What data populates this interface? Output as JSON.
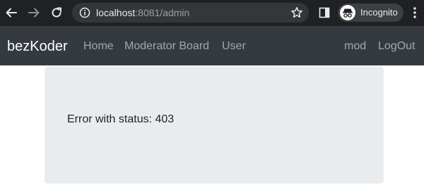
{
  "browser": {
    "url_host": "localhost",
    "url_rest": ":8081/admin",
    "profile_label": "Incognito"
  },
  "navbar": {
    "brand": "bezKoder",
    "links": [
      "Home",
      "Moderator Board",
      "User"
    ],
    "user_links": [
      "mod",
      "LogOut"
    ]
  },
  "content": {
    "message": "Error with status: 403"
  },
  "colors": {
    "chrome_bg": "#202124",
    "navbar_bg": "#343a40",
    "jumbotron_bg": "#e9ecef"
  }
}
